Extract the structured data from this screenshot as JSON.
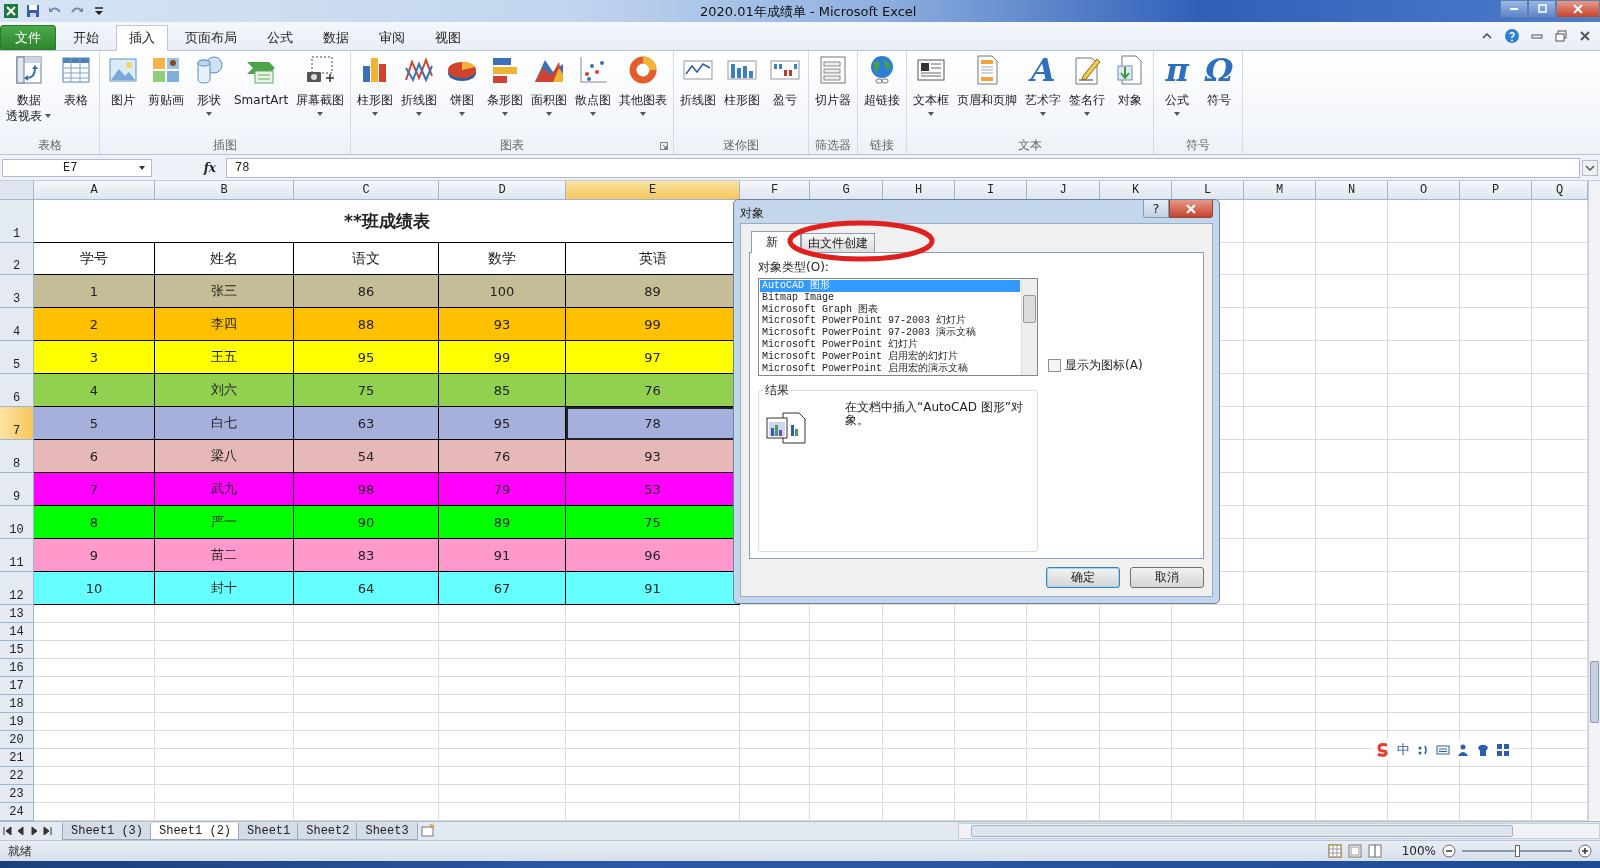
{
  "window": {
    "title": "2020.01年成绩单 - Microsoft Excel"
  },
  "menu_tabs": [
    {
      "label": "文件",
      "kind": "file",
      "selected": false
    },
    {
      "label": "开始",
      "kind": "tab",
      "selected": false
    },
    {
      "label": "插入",
      "kind": "tab",
      "selected": true
    },
    {
      "label": "页面布局",
      "kind": "tab",
      "selected": false
    },
    {
      "label": "公式",
      "kind": "tab",
      "selected": false
    },
    {
      "label": "数据",
      "kind": "tab",
      "selected": false
    },
    {
      "label": "审阅",
      "kind": "tab",
      "selected": false
    },
    {
      "label": "视图",
      "kind": "tab",
      "selected": false
    }
  ],
  "ribbon": [
    {
      "label": "表格",
      "items": [
        {
          "label": "数据",
          "label2": "透视表",
          "dropdown": true
        },
        {
          "label": "表格",
          "dropdown": false
        }
      ]
    },
    {
      "label": "插图",
      "items": [
        {
          "label": "图片",
          "dropdown": false
        },
        {
          "label": "剪贴画",
          "dropdown": false
        },
        {
          "label": "形状",
          "dropdown": true
        },
        {
          "label": "SmartArt",
          "dropdown": false
        },
        {
          "label": "屏幕截图",
          "dropdown": true
        }
      ]
    },
    {
      "label": "图表",
      "launcher": true,
      "items": [
        {
          "label": "柱形图",
          "dropdown": true
        },
        {
          "label": "折线图",
          "dropdown": true
        },
        {
          "label": "饼图",
          "dropdown": true
        },
        {
          "label": "条形图",
          "dropdown": true
        },
        {
          "label": "面积图",
          "dropdown": true
        },
        {
          "label": "散点图",
          "dropdown": true
        },
        {
          "label": "其他图表",
          "dropdown": true
        }
      ]
    },
    {
      "label": "迷你图",
      "items": [
        {
          "label": "折线图",
          "dropdown": false
        },
        {
          "label": "柱形图",
          "dropdown": false
        },
        {
          "label": "盈亏",
          "dropdown": false
        }
      ]
    },
    {
      "label": "筛选器",
      "items": [
        {
          "label": "切片器",
          "dropdown": false
        }
      ]
    },
    {
      "label": "链接",
      "items": [
        {
          "label": "超链接",
          "dropdown": false
        }
      ]
    },
    {
      "label": "文本",
      "items": [
        {
          "label": "文本框",
          "dropdown": true
        },
        {
          "label": "页眉和页脚",
          "dropdown": false
        },
        {
          "label": "艺术字",
          "dropdown": true,
          "glyph": "A"
        },
        {
          "label": "签名行",
          "dropdown": true
        },
        {
          "label": "对象",
          "dropdown": false
        }
      ]
    },
    {
      "label": "符号",
      "items": [
        {
          "label": "公式",
          "dropdown": true,
          "glyph": "π"
        },
        {
          "label": "符号",
          "dropdown": false,
          "glyph": "Ω"
        }
      ]
    }
  ],
  "formula_bar": {
    "name_box": "E7",
    "function_label": "fx",
    "value": "78"
  },
  "sheet": {
    "columns": [
      {
        "label": "A",
        "selected": false
      },
      {
        "label": "B",
        "selected": false
      },
      {
        "label": "C",
        "selected": false
      },
      {
        "label": "D",
        "selected": false
      },
      {
        "label": "E",
        "selected": true
      },
      {
        "label": "F",
        "selected": false
      },
      {
        "label": "G",
        "selected": false
      },
      {
        "label": "H",
        "selected": false
      },
      {
        "label": "I",
        "selected": false
      },
      {
        "label": "J",
        "selected": false
      },
      {
        "label": "K",
        "selected": false
      },
      {
        "label": "L",
        "selected": false
      },
      {
        "label": "M",
        "selected": false
      },
      {
        "label": "N",
        "selected": false
      },
      {
        "label": "O",
        "selected": false
      },
      {
        "label": "P",
        "selected": false
      },
      {
        "label": "Q",
        "selected": false
      }
    ],
    "row_numbers": [
      {
        "label": "1",
        "selected": false
      },
      {
        "label": "2",
        "selected": false
      },
      {
        "label": "3",
        "selected": false
      },
      {
        "label": "4",
        "selected": false
      },
      {
        "label": "5",
        "selected": false
      },
      {
        "label": "6",
        "selected": false
      },
      {
        "label": "7",
        "selected": true
      },
      {
        "label": "8",
        "selected": false
      },
      {
        "label": "9",
        "selected": false
      },
      {
        "label": "10",
        "selected": false
      },
      {
        "label": "11",
        "selected": false
      },
      {
        "label": "12",
        "selected": false
      },
      {
        "label": "13",
        "selected": false
      },
      {
        "label": "14",
        "selected": false
      },
      {
        "label": "15",
        "selected": false
      },
      {
        "label": "16",
        "selected": false
      },
      {
        "label": "17",
        "selected": false
      },
      {
        "label": "18",
        "selected": false
      },
      {
        "label": "19",
        "selected": false
      },
      {
        "label": "20",
        "selected": false
      },
      {
        "label": "21",
        "selected": false
      },
      {
        "label": "22",
        "selected": false
      },
      {
        "label": "23",
        "selected": false
      },
      {
        "label": "24",
        "selected": false
      }
    ],
    "title": "**班成绩表",
    "header": [
      "学号",
      "姓名",
      "语文",
      "数学",
      "英语"
    ],
    "rows": [
      {
        "color": "#c4bd97",
        "cells": [
          "1",
          "张三",
          "86",
          "100",
          "89"
        ]
      },
      {
        "color": "#ffc000",
        "cells": [
          "2",
          "李四",
          "88",
          "93",
          "99"
        ]
      },
      {
        "color": "#ffff00",
        "cells": [
          "3",
          "王五",
          "95",
          "99",
          "97"
        ]
      },
      {
        "color": "#92d050",
        "cells": [
          "4",
          "刘六",
          "75",
          "85",
          "76"
        ]
      },
      {
        "color": "#a6b0dc",
        "cells": [
          "5",
          "白七",
          "63",
          "95",
          "78"
        ]
      },
      {
        "color": "#e6b9b8",
        "cells": [
          "6",
          "梁八",
          "54",
          "76",
          "93"
        ]
      },
      {
        "color": "#ff00ff",
        "cells": [
          "7",
          "武九",
          "98",
          "79",
          "53"
        ]
      },
      {
        "color": "#00ff00",
        "cells": [
          "8",
          "严一",
          "90",
          "89",
          "75"
        ]
      },
      {
        "color": "#ff99cc",
        "cells": [
          "9",
          "苗二",
          "83",
          "91",
          "96"
        ]
      },
      {
        "color": "#66ffff",
        "cells": [
          "10",
          "封十",
          "64",
          "67",
          "91"
        ]
      }
    ]
  },
  "sheet_tabs": [
    {
      "label": "Sheet1 (3)",
      "selected": false
    },
    {
      "label": "Sheet1 (2)",
      "selected": true
    },
    {
      "label": "Sheet1",
      "selected": false
    },
    {
      "label": "Sheet2",
      "selected": false
    },
    {
      "label": "Sheet3",
      "selected": false
    }
  ],
  "status_bar": {
    "text": "就绪",
    "zoom": "100%",
    "zoom_slider": {
      "level": 0.5
    }
  },
  "ime_bar": {
    "mode": "中"
  },
  "dialog": {
    "title": "对象",
    "help": "?",
    "tabs": [
      {
        "label": "新",
        "selected": true
      },
      {
        "label": "由文件创建",
        "selected": false
      }
    ],
    "list_label": "对象类型(O):",
    "object_types": [
      {
        "label": "AutoCAD 图形",
        "selected": true
      },
      {
        "label": "Bitmap Image",
        "selected": false
      },
      {
        "label": "Microsoft Graph 图表",
        "selected": false
      },
      {
        "label": "Microsoft PowerPoint 97-2003 幻灯片",
        "selected": false
      },
      {
        "label": "Microsoft PowerPoint 97-2003 演示文稿",
        "selected": false
      },
      {
        "label": "Microsoft PowerPoint 幻灯片",
        "selected": false
      },
      {
        "label": "Microsoft PowerPoint 启用宏的幻灯片",
        "selected": false
      },
      {
        "label": "Microsoft PowerPoint 启用宏的演示文稿",
        "selected": false
      }
    ],
    "display_as_icon": {
      "label": "显示为图标(A)",
      "checked": false
    },
    "result_label": "结果",
    "result_text": "在文档中插入“AutoCAD 图形”对象。",
    "buttons": [
      "确定",
      "取消"
    ]
  }
}
